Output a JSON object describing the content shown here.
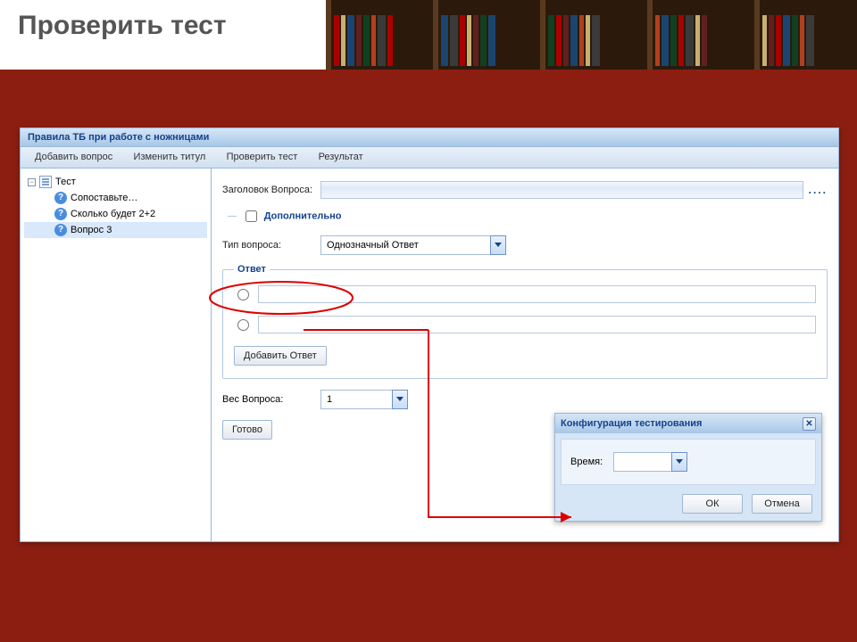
{
  "page_title": "Проверить тест",
  "window": {
    "title": "Правила ТБ при работе с ножницами"
  },
  "menu": {
    "add_question": "Добавить вопрос",
    "change_title": "Изменить титул",
    "check_test": "Проверить тест",
    "result": "Результат"
  },
  "tree": {
    "root": "Тест",
    "items": [
      "Сопоставьте…",
      "Сколько будет 2+2",
      "Вопрос 3"
    ],
    "selected_index": 2
  },
  "form": {
    "question_title_label": "Заголовок Вопроса:",
    "question_title_value": "",
    "additional_label": "Дополнительно",
    "question_type_label": "Тип вопроса:",
    "question_type_value": "Однозначный Ответ",
    "answer_legend": "Ответ",
    "answer1": "",
    "answer2": "",
    "add_answer_btn": "Добавить Ответ",
    "weight_label": "Вес Вопроса:",
    "weight_value": "1",
    "done_btn": "Готово"
  },
  "config_popup": {
    "title": "Конфигурация тестирования",
    "time_label": "Время:",
    "time_value": "",
    "ok": "ОК",
    "cancel": "Отмена"
  }
}
